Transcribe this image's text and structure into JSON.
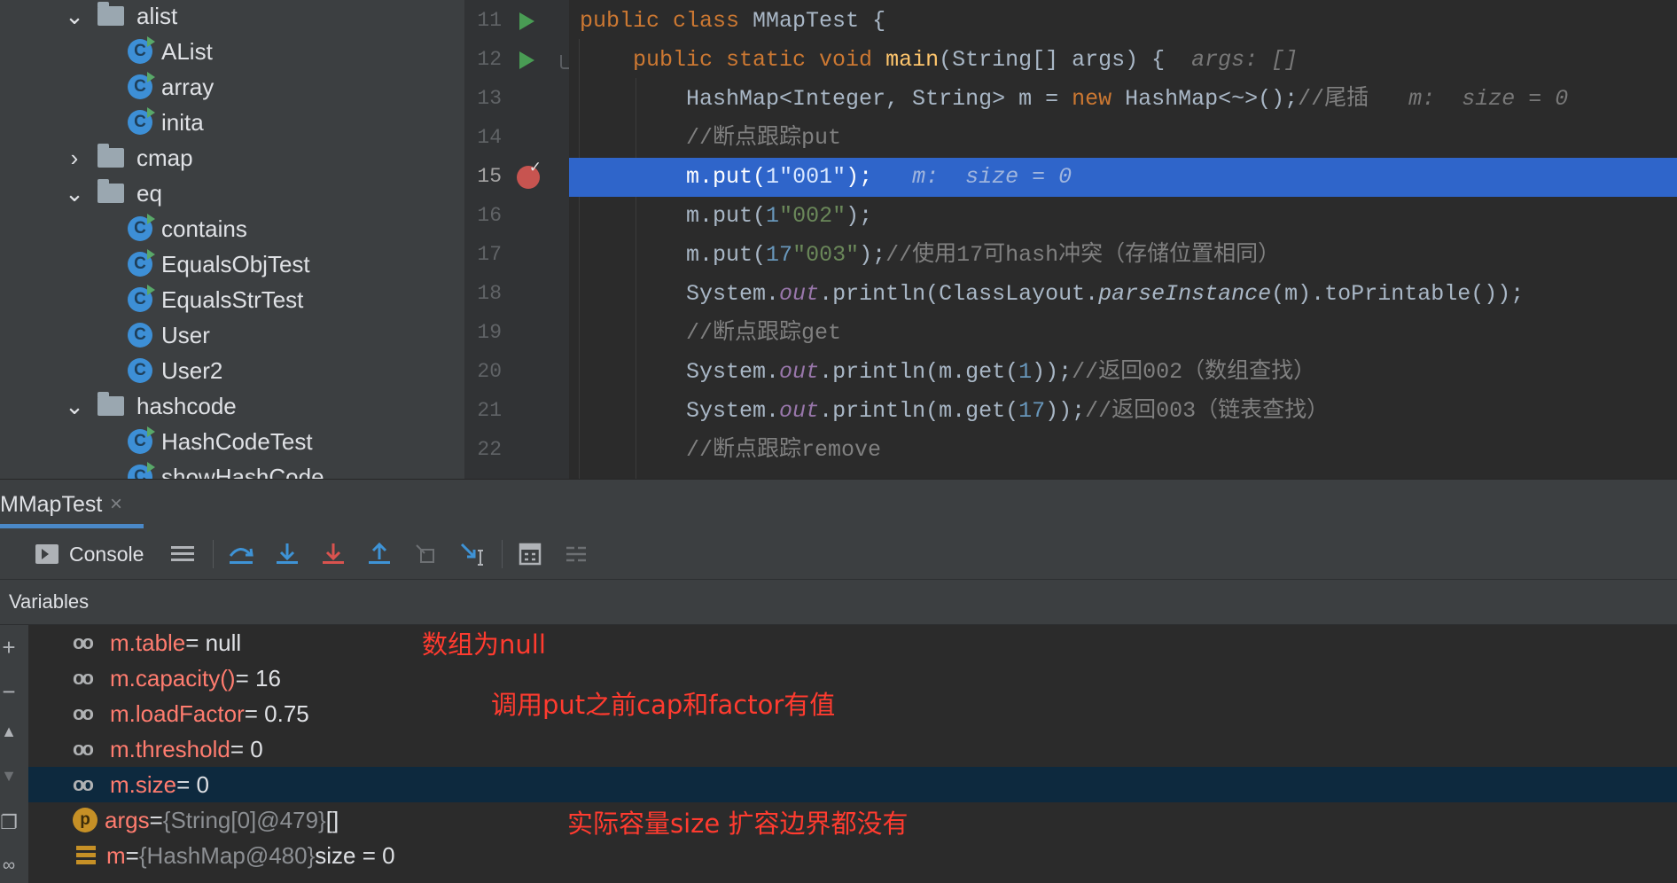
{
  "tree": {
    "items": [
      {
        "kind": "folder",
        "expanded": true,
        "label": "alist"
      },
      {
        "kind": "class",
        "label": "AList"
      },
      {
        "kind": "class",
        "label": "array"
      },
      {
        "kind": "class",
        "label": "inita"
      },
      {
        "kind": "folder",
        "expanded": false,
        "label": "cmap"
      },
      {
        "kind": "folder",
        "expanded": true,
        "label": "eq"
      },
      {
        "kind": "class",
        "label": "contains"
      },
      {
        "kind": "class",
        "label": "EqualsObjTest"
      },
      {
        "kind": "class",
        "label": "EqualsStrTest"
      },
      {
        "kind": "class",
        "label": "User"
      },
      {
        "kind": "class",
        "label": "User2"
      },
      {
        "kind": "folder",
        "expanded": true,
        "label": "hashcode"
      },
      {
        "kind": "class",
        "label": "HashCodeTest"
      },
      {
        "kind": "class",
        "label": "showHashCode"
      }
    ],
    "chevron_expanded": "⌄",
    "chevron_collapsed": "›",
    "class_letter": "C"
  },
  "editor": {
    "line_numbers": [
      "11",
      "12",
      "13",
      "14",
      "15",
      "16",
      "17",
      "18",
      "19",
      "20",
      "21",
      "22"
    ],
    "code": {
      "l11": {
        "a": "public class ",
        "b": "MMapTest {"
      },
      "l12": {
        "a": "    public static void ",
        "b": "main",
        "c": "(String[] args) {  ",
        "d": "args: []"
      },
      "l13": {
        "a": "        HashMap<Integer, String> m = ",
        "b": "new ",
        "c": "HashMap<~>();",
        "d": "//尾插",
        "e": "   m:  size = 0"
      },
      "l14": {
        "a": "        //断点跟踪put"
      },
      "l15": {
        "a": "        m.put(",
        "b": "1",
        ", ": ", ",
        "c": "\"001\"",
        "d": ");",
        "e": "   m:  size = 0"
      },
      "l16": {
        "a": "        m.put(",
        "b": "1",
        ", ": ", ",
        "c": "\"002\"",
        "d": ");"
      },
      "l17": {
        "a": "        m.put(",
        "b": "17",
        ", ": ", ",
        "c": "\"003\"",
        "d": ");",
        "e": "//使用17可hash冲突（存储位置相同）"
      },
      "l18": {
        "a": "        System.",
        "b": "out",
        "c": ".println(ClassLayout.",
        "d": "parseInstance",
        "e": "(m).toPrintable());"
      },
      "l19": {
        "a": "        //断点跟踪get"
      },
      "l20": {
        "a": "        System.",
        "b": "out",
        "c": ".println(m.get(",
        "d": "1",
        "e": "));",
        "f": "//返回002（数组查找）"
      },
      "l21": {
        "a": "        System.",
        "b": "out",
        "c": ".println(m.get(",
        "d": "17",
        "e": "));",
        "f": "//返回003（链表查找）"
      },
      "l22": {
        "a": "        //断点跟踪remove"
      }
    }
  },
  "debug": {
    "session_tab": "MMapTest",
    "close_glyph": "×",
    "console_label": "Console",
    "variables_title": "Variables",
    "toolbar_icons": [
      "frames-icon",
      "step-over-icon",
      "step-into-icon",
      "force-step-into-icon",
      "step-out-icon",
      "drop-frame-icon",
      "run-to-cursor-icon",
      "evaluate-expression-icon",
      "trace-current-stream-icon"
    ],
    "variables": [
      {
        "icon": "watch",
        "name": "m.table",
        "value": " = null",
        "extra": ""
      },
      {
        "icon": "watch",
        "name": "m.capacity()",
        "value": " = 16",
        "extra": ""
      },
      {
        "icon": "watch",
        "name": "m.loadFactor",
        "value": " = 0.75",
        "extra": ""
      },
      {
        "icon": "watch",
        "name": "m.threshold",
        "value": " = 0",
        "extra": ""
      },
      {
        "icon": "watch",
        "name": "m.size",
        "value": " = 0",
        "extra": ""
      },
      {
        "icon": "param",
        "name": "args",
        "value": " = ",
        "extra": "{String[0]@479}",
        "tail": " []"
      },
      {
        "icon": "field",
        "name": "m",
        "value": " = ",
        "extra": "{HashMap@480}",
        "tail": "  size = 0"
      }
    ],
    "selected_row": 4
  },
  "annotations": {
    "a1": "数组为null",
    "a2": "调用put之前cap和factor有值",
    "a3": "实际容量size 扩容边界都没有"
  },
  "colors": {
    "selection": "#2f65ca",
    "annotation": "#ff3b2f",
    "variable_name": "#ff7c6f"
  }
}
